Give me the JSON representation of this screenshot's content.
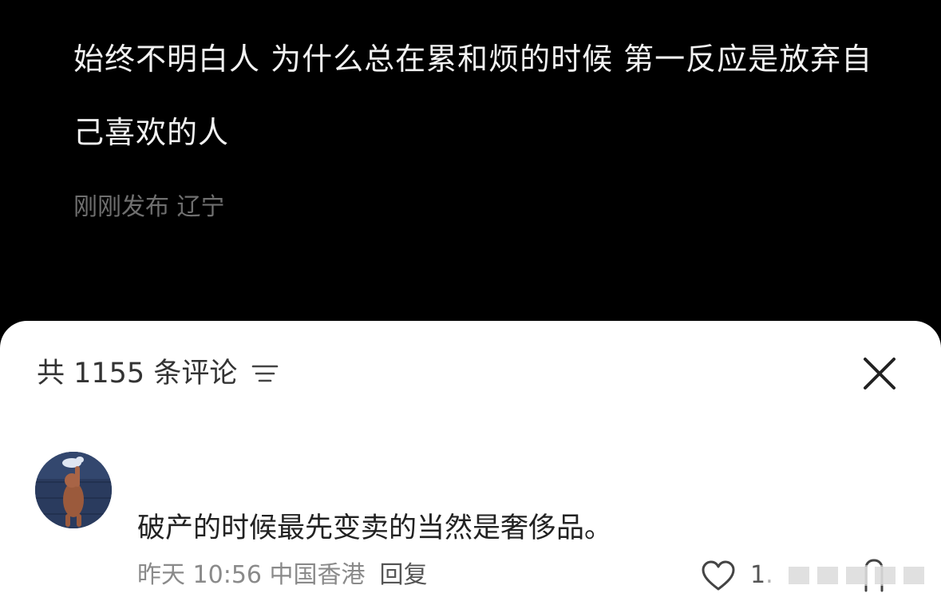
{
  "post": {
    "text": "始终不明白人 为什么总在累和烦的时候 第一反应是放弃自己喜欢的人",
    "meta": "刚刚发布 辽宁"
  },
  "comments_panel": {
    "count_label": "共 1155 条评论",
    "sort_icon": "sort-lines-icon",
    "close_icon": "close-x-icon"
  },
  "comment": {
    "avatar_icon": "cartoon-avatar-icon",
    "text": "破产的时候最先变卖的当然是奢侈品。",
    "time_location": "昨天 10:56 中国香港",
    "reply_label": "回复",
    "like_icon": "heart-outline-icon",
    "like_count": "1.",
    "dislike_icon": "thumb-down-outline-icon"
  },
  "colors": {
    "background": "#000000",
    "post_text": "#f2f2f2",
    "post_meta": "#6f6f6f",
    "sheet_bg": "#ffffff",
    "primary_text": "#222222",
    "secondary_text": "#8a8a8a"
  }
}
